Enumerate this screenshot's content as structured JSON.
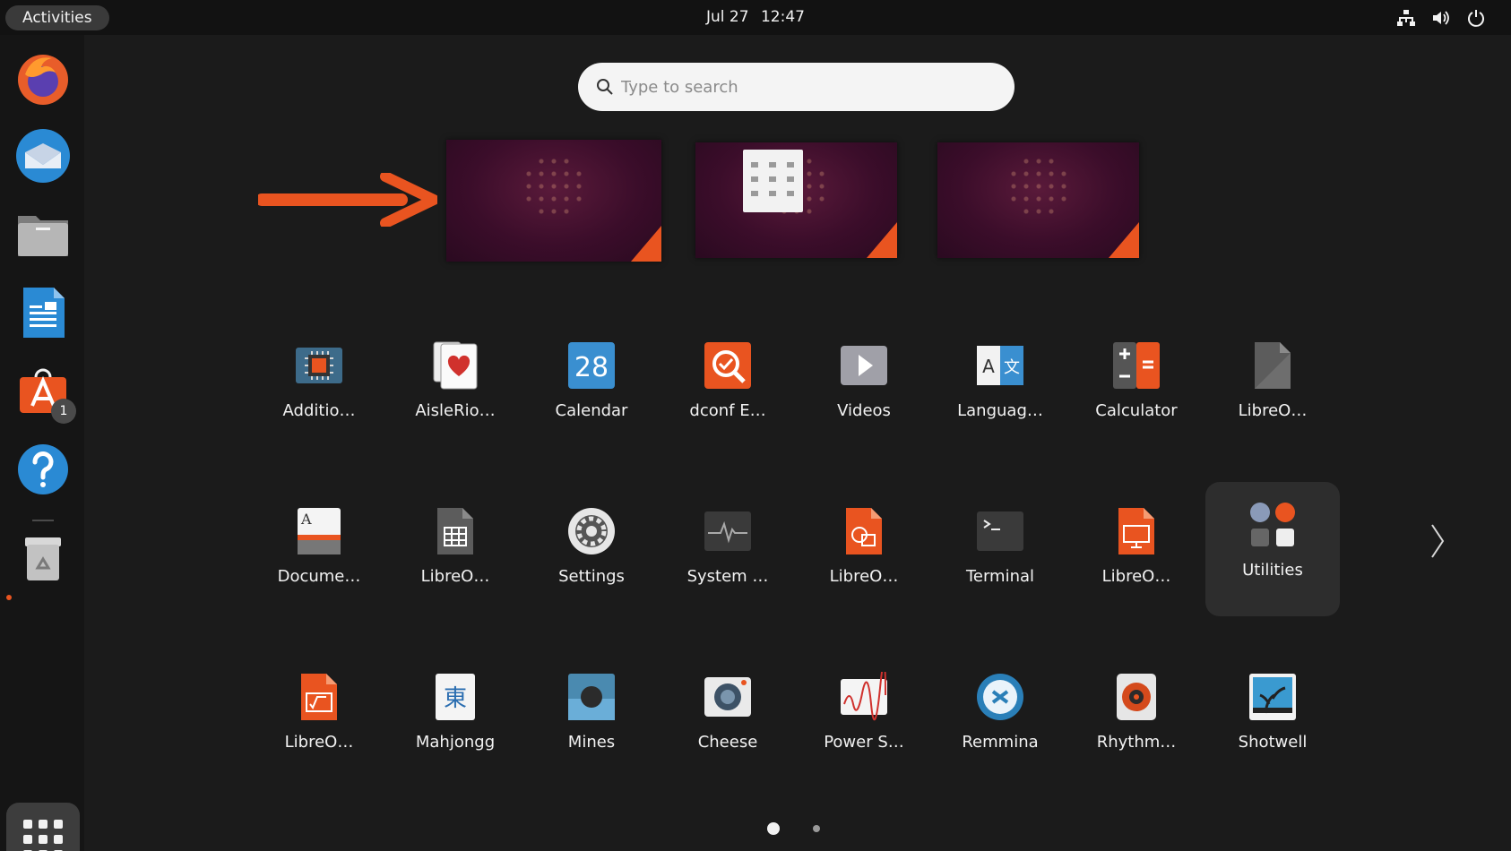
{
  "topbar": {
    "activities_label": "Activities",
    "date": "Jul 27",
    "time": "12:47",
    "tray_icons": [
      "network-icon",
      "volume-icon",
      "power-icon"
    ]
  },
  "dock": {
    "items": [
      {
        "name": "Firefox",
        "icon": "firefox-icon"
      },
      {
        "name": "Thunderbird",
        "icon": "thunderbird-icon"
      },
      {
        "name": "Files",
        "icon": "files-icon"
      },
      {
        "name": "LibreOffice Writer",
        "icon": "writer-icon"
      },
      {
        "name": "Ubuntu Software",
        "icon": "software-icon",
        "badge": "1"
      },
      {
        "name": "Help",
        "icon": "help-icon"
      },
      {
        "name": "Trash",
        "icon": "trash-icon"
      }
    ],
    "show_apps_icon": "grid-icon"
  },
  "search": {
    "placeholder": "Type to search"
  },
  "workspaces": [
    "workspace-1",
    "workspace-2",
    "workspace-3"
  ],
  "apps": [
    {
      "label": "Additio…",
      "icon": "chip-icon"
    },
    {
      "label": "AisleRio…",
      "icon": "cards-icon"
    },
    {
      "label": "Calendar",
      "icon": "calendar-icon",
      "day": "28"
    },
    {
      "label": "dconf E…",
      "icon": "dconf-icon"
    },
    {
      "label": "Videos",
      "icon": "videos-icon"
    },
    {
      "label": "Languag…",
      "icon": "language-icon"
    },
    {
      "label": "Calculator",
      "icon": "calculator-icon"
    },
    {
      "label": "LibreO…",
      "icon": "libreoffice-icon"
    },
    {
      "label": "Docume…",
      "icon": "document-viewer-icon"
    },
    {
      "label": "LibreO…",
      "icon": "calc-icon"
    },
    {
      "label": "Settings",
      "icon": "settings-icon"
    },
    {
      "label": "System …",
      "icon": "system-monitor-icon"
    },
    {
      "label": "LibreO…",
      "icon": "draw-icon"
    },
    {
      "label": "Terminal",
      "icon": "terminal-icon"
    },
    {
      "label": "LibreO…",
      "icon": "impress-icon"
    },
    {
      "label": "Utilities",
      "icon": "utilities-folder-icon"
    },
    {
      "label": "LibreO…",
      "icon": "math-icon"
    },
    {
      "label": "Mahjongg",
      "icon": "mahjongg-icon"
    },
    {
      "label": "Mines",
      "icon": "mines-icon"
    },
    {
      "label": "Cheese",
      "icon": "cheese-icon"
    },
    {
      "label": "Power S…",
      "icon": "power-statistics-icon"
    },
    {
      "label": "Remmina",
      "icon": "remmina-icon"
    },
    {
      "label": "Rhythm…",
      "icon": "rhythmbox-icon"
    },
    {
      "label": "Shotwell",
      "icon": "shotwell-icon"
    }
  ],
  "pager": {
    "pages": 2,
    "current": 1
  },
  "colors": {
    "accent": "#e95420",
    "panel": "#121212",
    "background": "#1b1b1b"
  }
}
